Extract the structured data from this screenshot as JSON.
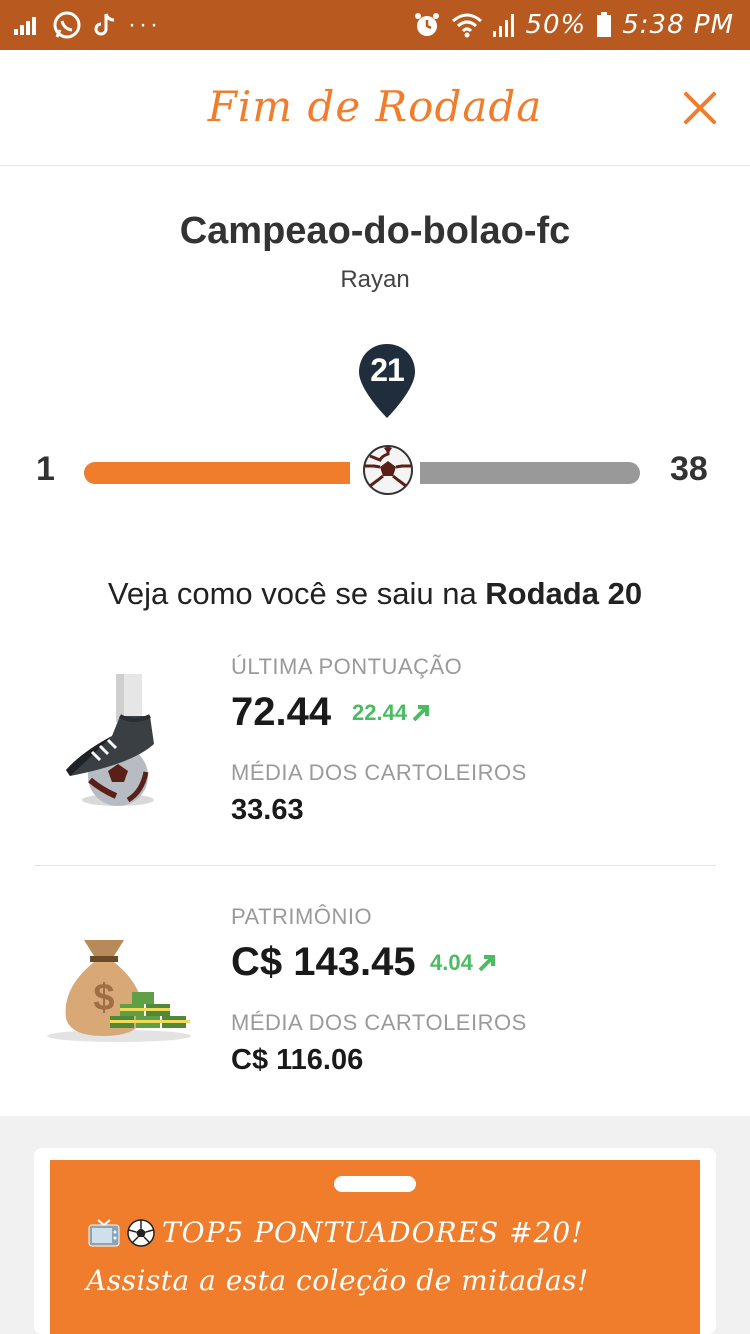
{
  "status_bar": {
    "battery": "50%",
    "time": "5:38 PM",
    "left_icons": [
      "signal-bars-icon",
      "whatsapp-icon",
      "tiktok-icon",
      "more-dots-icon"
    ],
    "right_icons": [
      "alarm-icon",
      "wifi-icon",
      "cell-signal-icon",
      "battery-icon"
    ]
  },
  "header": {
    "title": "Fim de Rodada",
    "close_icon": "close-icon"
  },
  "team": {
    "name": "Campeao-do-bolao-fc",
    "owner": "Rayan"
  },
  "progress": {
    "current_round": "21",
    "min": "1",
    "max": "38"
  },
  "summary": {
    "prefix": "Veja como você se saiu na ",
    "round_label": "Rodada 20"
  },
  "score": {
    "label": "ÚLTIMA PONTUAÇÃO",
    "value": "72.44",
    "delta": "22.44",
    "avg_label": "MÉDIA DOS CARTOLEIROS",
    "avg_value": "33.63"
  },
  "patrimony": {
    "label": "PATRIMÔNIO",
    "value": "C$ 143.45",
    "delta": "4.04",
    "avg_label": "MÉDIA DOS CARTOLEIROS",
    "avg_value": "C$ 116.06"
  },
  "promo": {
    "line1": "TOP5 PONTUADORES #20!",
    "line2": "Assista a esta coleção de mitadas!"
  },
  "colors": {
    "accent": "#ef7d2c",
    "status_bar": "#b85a1f",
    "positive": "#4cbb63",
    "pin": "#1f2d3d",
    "track": "#999999"
  }
}
